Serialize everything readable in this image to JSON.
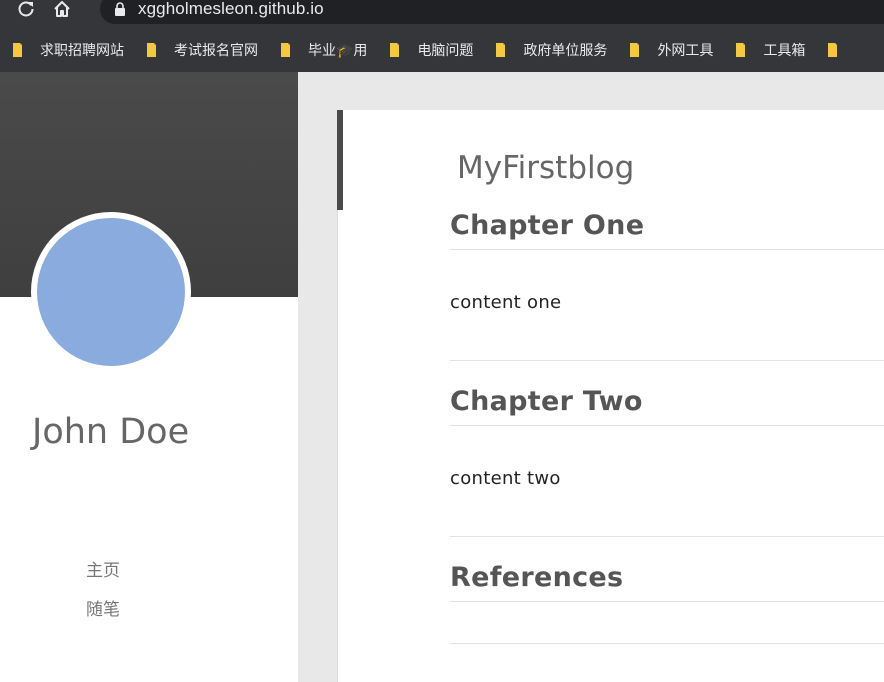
{
  "browser": {
    "url": "xggholmesleon.github.io",
    "bookmarks": [
      {
        "label": "求职招聘网站"
      },
      {
        "label": "考试报名官网"
      },
      {
        "label": "毕业🎓用"
      },
      {
        "label": "电脑问题"
      },
      {
        "label": "政府单位服务"
      },
      {
        "label": "外网工具"
      },
      {
        "label": "工具箱"
      }
    ]
  },
  "sidebar": {
    "author_name": "John Doe",
    "nav": [
      {
        "label": "主页"
      },
      {
        "label": "随笔"
      }
    ],
    "avatar_color": "#89abdd",
    "banner_color": "#4a4a4a"
  },
  "post": {
    "blog_title": "MyFirstblog",
    "sections": [
      {
        "heading": "Chapter One",
        "content": "content one"
      },
      {
        "heading": "Chapter Two",
        "content": "content two"
      },
      {
        "heading": "References",
        "content": ""
      }
    ]
  }
}
